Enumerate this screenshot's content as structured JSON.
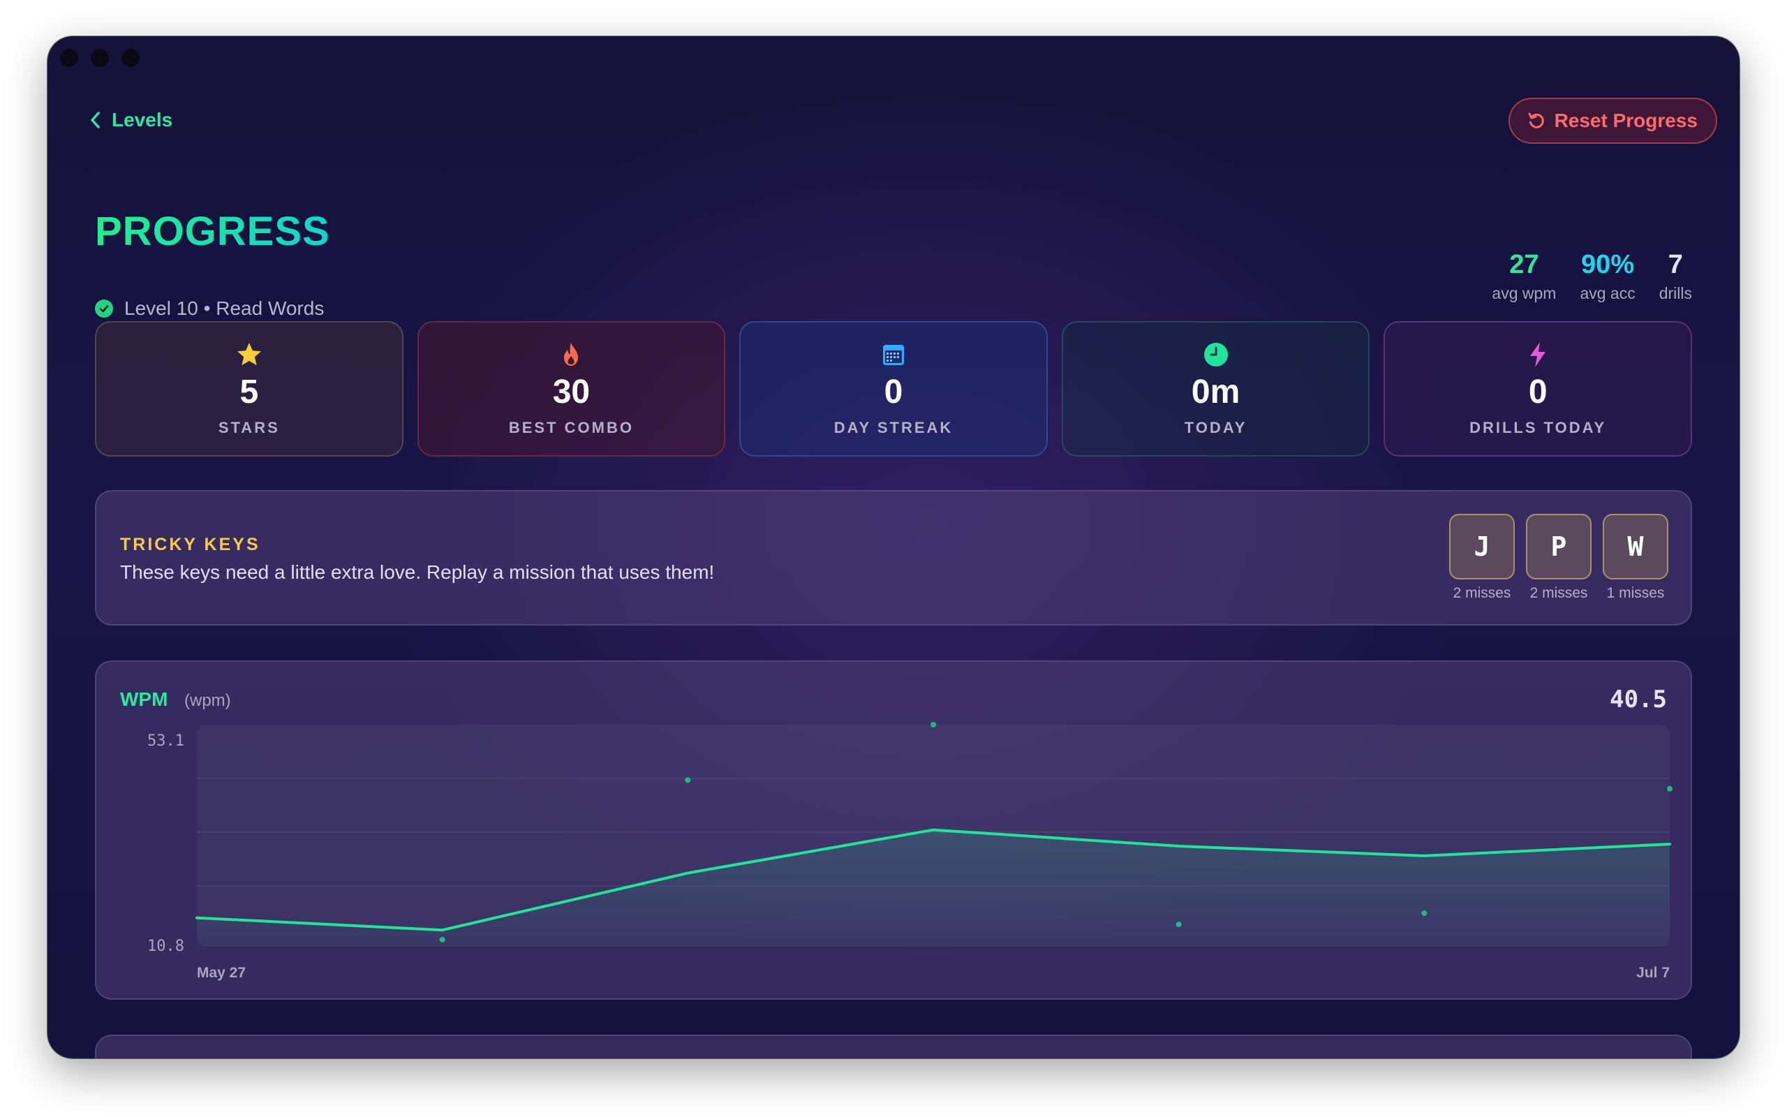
{
  "nav": {
    "back_label": "Levels",
    "reset_label": "Reset Progress"
  },
  "header": {
    "title": "PROGRESS",
    "subtitle": "Level 10 • Read Words"
  },
  "summary": [
    {
      "value": "27",
      "label": "avg wpm",
      "color": "#2ee8a0"
    },
    {
      "value": "90%",
      "label": "avg acc",
      "color": "#22d3ee"
    },
    {
      "value": "7",
      "label": "drills",
      "color": "#e6e2f2"
    }
  ],
  "cards": [
    {
      "icon": "star-icon",
      "value": "5",
      "label": "STARS"
    },
    {
      "icon": "flame-icon",
      "value": "30",
      "label": "BEST COMBO"
    },
    {
      "icon": "calendar-icon",
      "value": "0",
      "label": "DAY STREAK"
    },
    {
      "icon": "clock-icon",
      "value": "0m",
      "label": "TODAY"
    },
    {
      "icon": "bolt-icon",
      "value": "0",
      "label": "DRILLS TODAY"
    }
  ],
  "tricky": {
    "heading": "TRICKY KEYS",
    "description": "These keys need a little extra love. Replay a mission that uses them!",
    "keys": [
      {
        "key": "J",
        "misses": "2 misses"
      },
      {
        "key": "P",
        "misses": "2 misses"
      },
      {
        "key": "W",
        "misses": "1 misses"
      }
    ]
  },
  "chart": {
    "title": "WPM",
    "unit": "(wpm)",
    "current_value": "40.5",
    "y_max_label": "53.1",
    "y_min_label": "10.8",
    "x_start_label": "May 27",
    "x_end_label": "Jul 7"
  },
  "chart_data": {
    "type": "line",
    "ylim": [
      10.8,
      53.1
    ],
    "x_labels": [
      "May 27",
      "Jul 7"
    ],
    "series": [
      {
        "values": [
          15.1,
          12.7,
          23.9,
          32.4,
          29.2,
          27.3,
          29.6
        ]
      },
      {
        "values": [
          null,
          10.8,
          42.2,
          53.1,
          13.8,
          16.0,
          40.5
        ]
      }
    ],
    "grid": true,
    "line_color": "#22e39a",
    "point_color": "#1fb886"
  }
}
